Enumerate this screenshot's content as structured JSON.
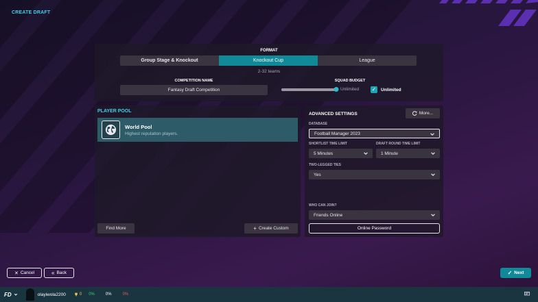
{
  "header": {
    "title": "CREATE DRAFT"
  },
  "format": {
    "label": "FORMAT",
    "tabs": [
      {
        "label": "Group Stage & Knockout",
        "active": false
      },
      {
        "label": "Knockout Cup",
        "active": true
      },
      {
        "label": "League",
        "active": false
      }
    ],
    "teams_range": "2-32 teams"
  },
  "competition": {
    "label": "COMPETITION NAME",
    "value": "Fantasy Draft Competition"
  },
  "squad_budget": {
    "label": "SQUAD BUDGET",
    "slider_value": "Unlimited",
    "slider_level": 1.0,
    "checkbox_label": "Unlimited",
    "checked": true
  },
  "player_pool": {
    "title": "PLAYER POOL",
    "items": [
      {
        "name": "World Pool",
        "description": "Highest reputation players."
      }
    ],
    "find_more_label": "Find More",
    "create_custom_label": "Create Custom"
  },
  "advanced": {
    "title": "ADVANCED SETTINGS",
    "more_label": "More...",
    "database": {
      "label": "DATABASE",
      "value": "Football Manager 2023"
    },
    "shortlist_time": {
      "label": "SHORTLIST TIME LIMIT",
      "value": "5 Minutes"
    },
    "draft_round_time": {
      "label": "DRAFT ROUND TIME LIMIT",
      "value": "1 Minute"
    },
    "two_legged": {
      "label": "TWO-LEGGED TIES",
      "value": "Yes"
    },
    "who_can_join": {
      "label": "WHO CAN JOIN?",
      "value": "Friends Online"
    },
    "password_label": "Online Password"
  },
  "nav": {
    "cancel_label": "Cancel",
    "back_label": "Back",
    "next_label": "Next"
  },
  "status_bar": {
    "logo": "FD",
    "username": "olayiwola2200",
    "trophies": "0",
    "stat_green": "0%",
    "stat_white": "0%",
    "stat_red": "0%"
  },
  "colors": {
    "accent": "#108a96",
    "title_cyan": "#3fd0e8",
    "panel": "#1e1828",
    "status_bar": "#1a3440"
  }
}
